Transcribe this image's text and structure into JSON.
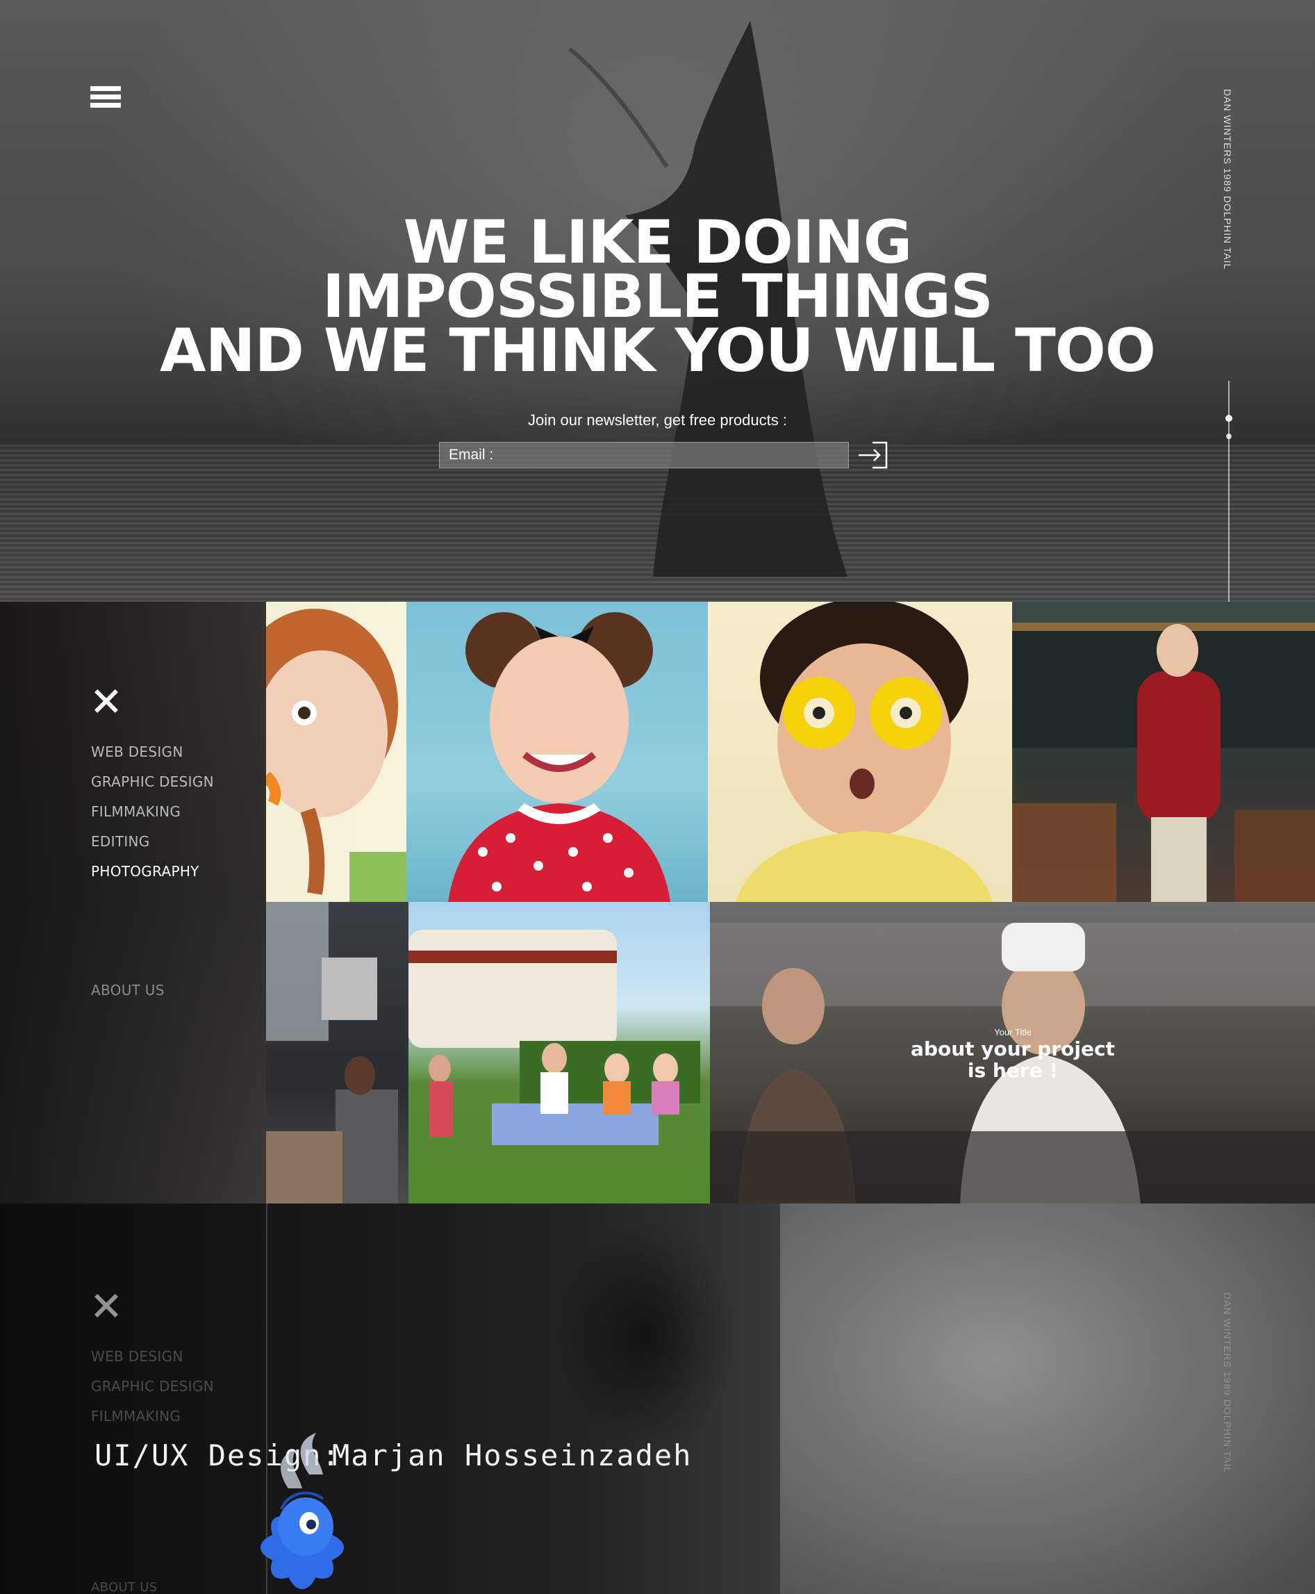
{
  "hero": {
    "headline_line1": "WE LIKE DOING",
    "headline_line2": "IMPOSSIBLE THINGS",
    "headline_line3": "AND WE THINK YOU WILL TOO",
    "newsletter_text": "Join our newsletter, get free products :",
    "email_placeholder": "Email :",
    "photo_credit": "DAN WINTERS 1989 DOLPHIN TAIL"
  },
  "menu": {
    "items": [
      "WEB DESIGN",
      "GRAPHIC DESIGN",
      "FILMMAKING",
      "EDITING",
      "PHOTOGRAPHY"
    ],
    "active": "PHOTOGRAPHY",
    "about": "ABOUT US"
  },
  "project": {
    "small_title": "Your Title",
    "title_line1": "about your project",
    "title_line2": "is here !"
  },
  "lower": {
    "menu_items": [
      "WEB DESIGN",
      "GRAPHIC DESIGN",
      "FILMMAKING"
    ],
    "about": "ABOUT US",
    "photo_credit": "DAN WINTERS 1989 DOLPHIN TAIL"
  },
  "credit": {
    "label": "UI/UX Design:",
    "name": "Marjan Hosseinzadeh"
  },
  "colors": {
    "text": "#ffffff",
    "menu_inactive": "#b9b9b9",
    "mascot_blue": "#2f6de8"
  }
}
